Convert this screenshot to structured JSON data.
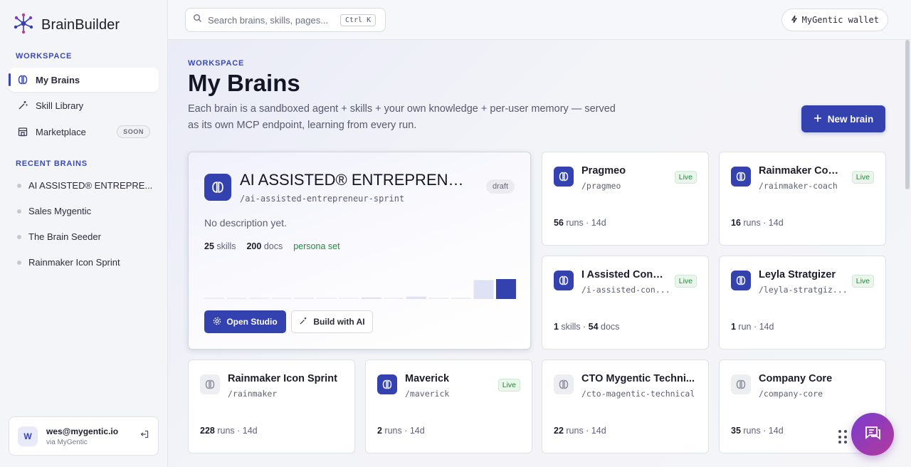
{
  "app": {
    "name": "BrainBuilder"
  },
  "sidebar": {
    "workspace_label": "WORKSPACE",
    "nav": [
      {
        "label": "My Brains",
        "icon": "brain-icon",
        "active": true
      },
      {
        "label": "Skill Library",
        "icon": "wand-icon"
      },
      {
        "label": "Marketplace",
        "icon": "store-icon",
        "badge": "SOON"
      }
    ],
    "recent_label": "RECENT BRAINS",
    "recent": [
      "AI ASSISTED® ENTREPRE...",
      "Sales Mygentic",
      "The Brain Seeder",
      "Rainmaker Icon Sprint"
    ],
    "user": {
      "initial": "W",
      "email": "wes@mygentic.io",
      "sub": "via MyGentic"
    }
  },
  "topbar": {
    "search_placeholder": "Search brains, skills, pages...",
    "shortcut": "Ctrl K",
    "wallet_label": "MyGentic wallet"
  },
  "main": {
    "eyebrow": "WORKSPACE",
    "title": "My Brains",
    "subtitle": "Each brain is a sandboxed agent + skills + your own knowledge + per-user memory — served as its own MCP endpoint, learning from every run.",
    "new_button": "New brain",
    "featured": {
      "name": "AI ASSISTED® ENTREPRENEU...",
      "slug": "/ai-assisted-entrepreneur-sprint",
      "status": "draft",
      "description": "No description yet.",
      "skills_count": "25",
      "skills_label": "skills",
      "docs_count": "200",
      "docs_label": "docs",
      "persona": "persona set",
      "activity": [
        0.05,
        0.05,
        0.05,
        0.05,
        0.05,
        0.05,
        0.05,
        0.08,
        0.05,
        0.12,
        0.05,
        0.05,
        0.95,
        1.0
      ],
      "open_button": "Open Studio",
      "build_button": "Build with AI"
    },
    "cards": [
      {
        "name": "Pragmeo",
        "slug": "/pragmeo",
        "live": "Live",
        "n": "56",
        "rest": " runs · 14d",
        "active": true
      },
      {
        "name": "Rainmaker Coach",
        "slug": "/rainmaker-coach",
        "live": "Live",
        "n": "16",
        "rest": " runs · 14d",
        "active": true
      },
      {
        "name": "I Assisted Cons...",
        "slug": "/i-assisted-con...",
        "live": "Live",
        "n": "1",
        "rest": " skills · ",
        "n2": "54",
        "rest2": " docs",
        "active": true
      },
      {
        "name": "Leyla Stratgizer",
        "slug": "/leyla-stratgiz...",
        "live": "Live",
        "n": "1",
        "rest": " run · 14d",
        "active": true
      },
      {
        "name": "Rainmaker Icon Sprint",
        "slug": "/rainmaker",
        "live": "",
        "n": "228",
        "rest": " runs · 14d",
        "active": false
      },
      {
        "name": "Maverick",
        "slug": "/maverick",
        "live": "Live",
        "n": "2",
        "rest": " runs · 14d",
        "active": true
      },
      {
        "name": "CTO Mygentic Techni...",
        "slug": "/cto-magentic-technical",
        "live": "",
        "n": "22",
        "rest": " runs · 14d",
        "active": false
      },
      {
        "name": "Company Core",
        "slug": "/company-core",
        "live": "",
        "n": "35",
        "rest": " runs · 14d",
        "active": false
      }
    ]
  },
  "colors": {
    "accent": "#3442b0",
    "live": "#1f8a3a",
    "fab": "#9a3bb5"
  }
}
